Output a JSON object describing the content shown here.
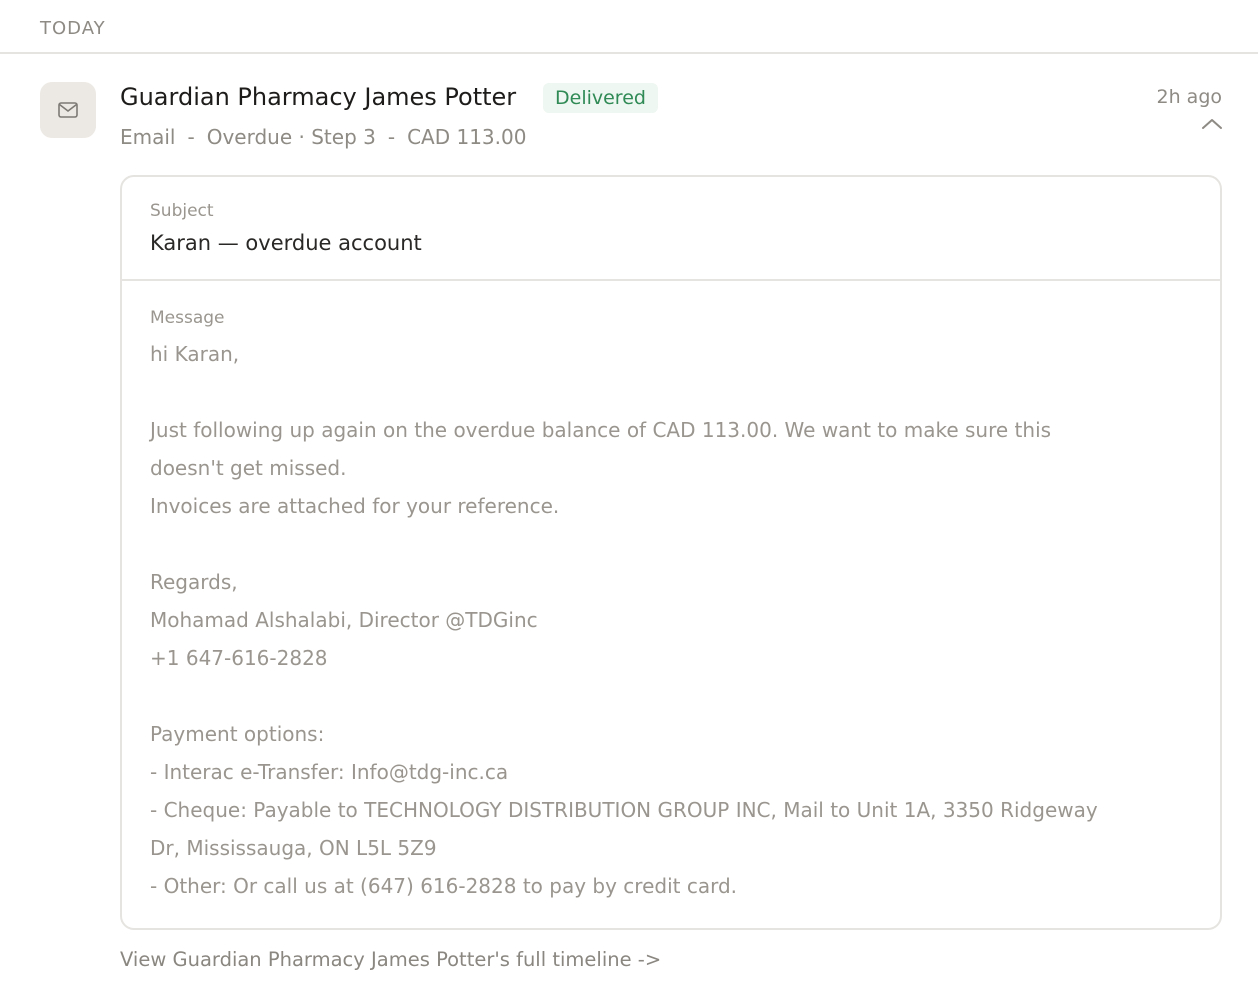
{
  "section": {
    "title": "TODAY"
  },
  "activity": {
    "icon": "mail-icon",
    "contact_name": "Guardian Pharmacy James Potter",
    "status": "Delivered",
    "timestamp": "2h ago",
    "meta": {
      "channel": "Email",
      "separator": "-",
      "stage": "Overdue · Step 3",
      "amount": "CAD 113.00"
    },
    "subject_label": "Subject",
    "subject": "Karan — overdue account",
    "message_label": "Message",
    "message_lines": [
      "hi Karan,",
      "",
      "Just following up again on the overdue balance of CAD 113.00. We want to make sure this",
      "doesn't get missed.",
      "Invoices are attached for your reference.",
      "",
      "Regards,",
      "Mohamad Alshalabi, Director @TDGinc",
      "+1 647-616-2828",
      "",
      "Payment options:",
      "- Interac e-Transfer: Info@tdg-inc.ca",
      "- Cheque: Payable to TECHNOLOGY DISTRIBUTION GROUP INC, Mail to Unit 1A, 3350 Ridgeway",
      "Dr, Mississauga, ON L5L 5Z9",
      "- Other: Or call us at (647) 616-2828 to pay by credit card."
    ],
    "timeline_link": "View Guardian Pharmacy James Potter's full timeline ->"
  },
  "colors": {
    "status_green": "#2f8a55",
    "status_bg": "#eef7f1",
    "muted_text": "#8e8a84",
    "border": "#e6e4e0"
  }
}
